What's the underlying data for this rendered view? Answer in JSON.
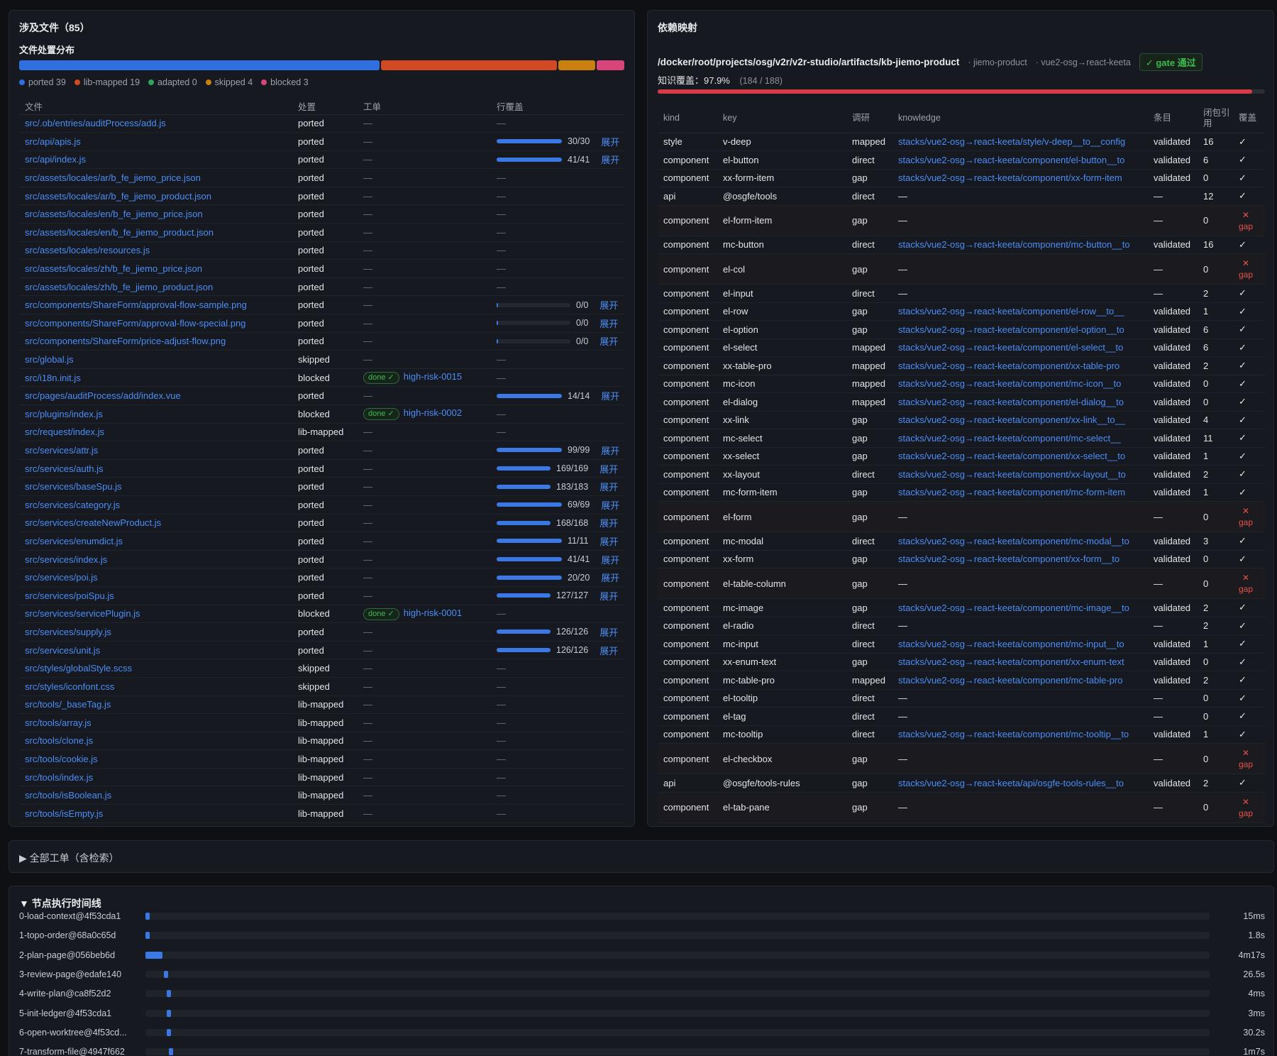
{
  "left": {
    "title": "涉及文件（85）",
    "dist_title": "文件处置分布",
    "dist": [
      {
        "name": "ported",
        "count": 39,
        "color": "#2f6fe0"
      },
      {
        "name": "lib-mapped",
        "count": 19,
        "color": "#d14a24"
      },
      {
        "name": "adapted",
        "count": 0,
        "color": "#2ea35b"
      },
      {
        "name": "skipped",
        "count": 4,
        "color": "#c9800e"
      },
      {
        "name": "blocked",
        "count": 3,
        "color": "#d8457a"
      }
    ],
    "legend": [
      "ported 39",
      "lib-mapped 19",
      "adapted 0",
      "skipped 4",
      "blocked 3"
    ],
    "headers": {
      "file": "文件",
      "disp": "处置",
      "ticket": "工单",
      "cov": "行覆盖"
    },
    "expand_label": "展开",
    "rows": [
      {
        "file": "src/.ob/entries/auditProcess/add.js",
        "disp": "ported",
        "ticket": "—",
        "done": "",
        "cov": "—",
        "frac": null
      },
      {
        "file": "src/api/apis.js",
        "disp": "ported",
        "ticket": "—",
        "done": "",
        "cov": "30/30",
        "frac": 1
      },
      {
        "file": "src/api/index.js",
        "disp": "ported",
        "ticket": "—",
        "done": "",
        "cov": "41/41",
        "frac": 1
      },
      {
        "file": "src/assets/locales/ar/b_fe_jiemo_price.json",
        "disp": "ported",
        "ticket": "—",
        "done": "",
        "cov": "—",
        "frac": null
      },
      {
        "file": "src/assets/locales/ar/b_fe_jiemo_product.json",
        "disp": "ported",
        "ticket": "—",
        "done": "",
        "cov": "—",
        "frac": null
      },
      {
        "file": "src/assets/locales/en/b_fe_jiemo_price.json",
        "disp": "ported",
        "ticket": "—",
        "done": "",
        "cov": "—",
        "frac": null
      },
      {
        "file": "src/assets/locales/en/b_fe_jiemo_product.json",
        "disp": "ported",
        "ticket": "—",
        "done": "",
        "cov": "—",
        "frac": null
      },
      {
        "file": "src/assets/locales/resources.js",
        "disp": "ported",
        "ticket": "—",
        "done": "",
        "cov": "—",
        "frac": null
      },
      {
        "file": "src/assets/locales/zh/b_fe_jiemo_price.json",
        "disp": "ported",
        "ticket": "—",
        "done": "",
        "cov": "—",
        "frac": null
      },
      {
        "file": "src/assets/locales/zh/b_fe_jiemo_product.json",
        "disp": "ported",
        "ticket": "—",
        "done": "",
        "cov": "—",
        "frac": null
      },
      {
        "file": "src/components/ShareForm/approval-flow-sample.png",
        "disp": "ported",
        "ticket": "—",
        "done": "",
        "cov": "0/0",
        "frac": 0
      },
      {
        "file": "src/components/ShareForm/approval-flow-special.png",
        "disp": "ported",
        "ticket": "—",
        "done": "",
        "cov": "0/0",
        "frac": 0
      },
      {
        "file": "src/components/ShareForm/price-adjust-flow.png",
        "disp": "ported",
        "ticket": "—",
        "done": "",
        "cov": "0/0",
        "frac": 0
      },
      {
        "file": "src/global.js",
        "disp": "skipped",
        "ticket": "—",
        "done": "",
        "cov": "—",
        "frac": null
      },
      {
        "file": "src/i18n.init.js",
        "disp": "blocked",
        "ticket": "high-risk-0015",
        "done": "done ✓",
        "cov": "—",
        "frac": null
      },
      {
        "file": "src/pages/auditProcess/add/index.vue",
        "disp": "ported",
        "ticket": "—",
        "done": "",
        "cov": "14/14",
        "frac": 1
      },
      {
        "file": "src/plugins/index.js",
        "disp": "blocked",
        "ticket": "high-risk-0002",
        "done": "done ✓",
        "cov": "—",
        "frac": null
      },
      {
        "file": "src/request/index.js",
        "disp": "lib-mapped",
        "ticket": "—",
        "done": "",
        "cov": "—",
        "frac": null
      },
      {
        "file": "src/services/attr.js",
        "disp": "ported",
        "ticket": "—",
        "done": "",
        "cov": "99/99",
        "frac": 1
      },
      {
        "file": "src/services/auth.js",
        "disp": "ported",
        "ticket": "—",
        "done": "",
        "cov": "169/169",
        "frac": 1
      },
      {
        "file": "src/services/baseSpu.js",
        "disp": "ported",
        "ticket": "—",
        "done": "",
        "cov": "183/183",
        "frac": 1
      },
      {
        "file": "src/services/category.js",
        "disp": "ported",
        "ticket": "—",
        "done": "",
        "cov": "69/69",
        "frac": 1
      },
      {
        "file": "src/services/createNewProduct.js",
        "disp": "ported",
        "ticket": "—",
        "done": "",
        "cov": "168/168",
        "frac": 1
      },
      {
        "file": "src/services/enumdict.js",
        "disp": "ported",
        "ticket": "—",
        "done": "",
        "cov": "11/11",
        "frac": 1
      },
      {
        "file": "src/services/index.js",
        "disp": "ported",
        "ticket": "—",
        "done": "",
        "cov": "41/41",
        "frac": 1
      },
      {
        "file": "src/services/poi.js",
        "disp": "ported",
        "ticket": "—",
        "done": "",
        "cov": "20/20",
        "frac": 1
      },
      {
        "file": "src/services/poiSpu.js",
        "disp": "ported",
        "ticket": "—",
        "done": "",
        "cov": "127/127",
        "frac": 1
      },
      {
        "file": "src/services/servicePlugin.js",
        "disp": "blocked",
        "ticket": "high-risk-0001",
        "done": "done ✓",
        "cov": "—",
        "frac": null
      },
      {
        "file": "src/services/supply.js",
        "disp": "ported",
        "ticket": "—",
        "done": "",
        "cov": "126/126",
        "frac": 1
      },
      {
        "file": "src/services/unit.js",
        "disp": "ported",
        "ticket": "—",
        "done": "",
        "cov": "126/126",
        "frac": 1
      },
      {
        "file": "src/styles/globalStyle.scss",
        "disp": "skipped",
        "ticket": "—",
        "done": "",
        "cov": "—",
        "frac": null
      },
      {
        "file": "src/styles/iconfont.css",
        "disp": "skipped",
        "ticket": "—",
        "done": "",
        "cov": "—",
        "frac": null
      },
      {
        "file": "src/tools/_baseTag.js",
        "disp": "lib-mapped",
        "ticket": "—",
        "done": "",
        "cov": "—",
        "frac": null
      },
      {
        "file": "src/tools/array.js",
        "disp": "lib-mapped",
        "ticket": "—",
        "done": "",
        "cov": "—",
        "frac": null
      },
      {
        "file": "src/tools/clone.js",
        "disp": "lib-mapped",
        "ticket": "—",
        "done": "",
        "cov": "—",
        "frac": null
      },
      {
        "file": "src/tools/cookie.js",
        "disp": "lib-mapped",
        "ticket": "—",
        "done": "",
        "cov": "—",
        "frac": null
      },
      {
        "file": "src/tools/index.js",
        "disp": "lib-mapped",
        "ticket": "—",
        "done": "",
        "cov": "—",
        "frac": null
      },
      {
        "file": "src/tools/isBoolean.js",
        "disp": "lib-mapped",
        "ticket": "—",
        "done": "",
        "cov": "—",
        "frac": null
      },
      {
        "file": "src/tools/isEmpty.js",
        "disp": "lib-mapped",
        "ticket": "—",
        "done": "",
        "cov": "—",
        "frac": null
      }
    ]
  },
  "right": {
    "title": "依赖映射",
    "path": "/docker/root/projects/osg/v2r/v2r-studio/artifacts/kb-jiemo-product",
    "tag1": "· jiemo-product",
    "tag2": "· vue2-osg→react-keeta",
    "gate": "✓ gate 通过",
    "kcov_label": "知识覆盖：97.9%",
    "kcov_count": "(184 / 188)",
    "kcov_frac": 0.979,
    "headers": {
      "kind": "kind",
      "key": "key",
      "research": "调研",
      "knowledge": "knowledge",
      "entry": "条目",
      "refs": "闭包引用",
      "cover": "覆盖"
    },
    "rows": [
      {
        "kind": "style",
        "key": "v-deep",
        "research": "mapped",
        "knowledge": "stacks/vue2-osg→react-keeta/style/v-deep__to__config",
        "entry": "validated",
        "refs": "16",
        "ok": true
      },
      {
        "kind": "component",
        "key": "el-button",
        "research": "direct",
        "knowledge": "stacks/vue2-osg→react-keeta/component/el-button__to",
        "entry": "validated",
        "refs": "6",
        "ok": true
      },
      {
        "kind": "component",
        "key": "xx-form-item",
        "research": "gap",
        "knowledge": "stacks/vue2-osg→react-keeta/component/xx-form-item",
        "entry": "validated",
        "refs": "0",
        "ok": true
      },
      {
        "kind": "api",
        "key": "@osgfe/tools",
        "research": "direct",
        "knowledge": "—",
        "entry": "—",
        "refs": "12",
        "ok": true
      },
      {
        "kind": "component",
        "key": "el-form-item",
        "research": "gap",
        "knowledge": "—",
        "entry": "—",
        "refs": "0",
        "ok": false
      },
      {
        "kind": "component",
        "key": "mc-button",
        "research": "direct",
        "knowledge": "stacks/vue2-osg→react-keeta/component/mc-button__to",
        "entry": "validated",
        "refs": "16",
        "ok": true
      },
      {
        "kind": "component",
        "key": "el-col",
        "research": "gap",
        "knowledge": "—",
        "entry": "—",
        "refs": "0",
        "ok": false
      },
      {
        "kind": "component",
        "key": "el-input",
        "research": "direct",
        "knowledge": "—",
        "entry": "—",
        "refs": "2",
        "ok": true
      },
      {
        "kind": "component",
        "key": "el-row",
        "research": "gap",
        "knowledge": "stacks/vue2-osg→react-keeta/component/el-row__to__",
        "entry": "validated",
        "refs": "1",
        "ok": true
      },
      {
        "kind": "component",
        "key": "el-option",
        "research": "gap",
        "knowledge": "stacks/vue2-osg→react-keeta/component/el-option__to",
        "entry": "validated",
        "refs": "6",
        "ok": true
      },
      {
        "kind": "component",
        "key": "el-select",
        "research": "mapped",
        "knowledge": "stacks/vue2-osg→react-keeta/component/el-select__to",
        "entry": "validated",
        "refs": "6",
        "ok": true
      },
      {
        "kind": "component",
        "key": "xx-table-pro",
        "research": "mapped",
        "knowledge": "stacks/vue2-osg→react-keeta/component/xx-table-pro",
        "entry": "validated",
        "refs": "2",
        "ok": true
      },
      {
        "kind": "component",
        "key": "mc-icon",
        "research": "mapped",
        "knowledge": "stacks/vue2-osg→react-keeta/component/mc-icon__to",
        "entry": "validated",
        "refs": "0",
        "ok": true
      },
      {
        "kind": "component",
        "key": "el-dialog",
        "research": "mapped",
        "knowledge": "stacks/vue2-osg→react-keeta/component/el-dialog__to",
        "entry": "validated",
        "refs": "0",
        "ok": true
      },
      {
        "kind": "component",
        "key": "xx-link",
        "research": "gap",
        "knowledge": "stacks/vue2-osg→react-keeta/component/xx-link__to__",
        "entry": "validated",
        "refs": "4",
        "ok": true
      },
      {
        "kind": "component",
        "key": "mc-select",
        "research": "gap",
        "knowledge": "stacks/vue2-osg→react-keeta/component/mc-select__",
        "entry": "validated",
        "refs": "11",
        "ok": true
      },
      {
        "kind": "component",
        "key": "xx-select",
        "research": "gap",
        "knowledge": "stacks/vue2-osg→react-keeta/component/xx-select__to",
        "entry": "validated",
        "refs": "1",
        "ok": true
      },
      {
        "kind": "component",
        "key": "xx-layout",
        "research": "direct",
        "knowledge": "stacks/vue2-osg→react-keeta/component/xx-layout__to",
        "entry": "validated",
        "refs": "2",
        "ok": true
      },
      {
        "kind": "component",
        "key": "mc-form-item",
        "research": "gap",
        "knowledge": "stacks/vue2-osg→react-keeta/component/mc-form-item",
        "entry": "validated",
        "refs": "1",
        "ok": true
      },
      {
        "kind": "component",
        "key": "el-form",
        "research": "gap",
        "knowledge": "—",
        "entry": "—",
        "refs": "0",
        "ok": false
      },
      {
        "kind": "component",
        "key": "mc-modal",
        "research": "direct",
        "knowledge": "stacks/vue2-osg→react-keeta/component/mc-modal__to",
        "entry": "validated",
        "refs": "3",
        "ok": true
      },
      {
        "kind": "component",
        "key": "xx-form",
        "research": "gap",
        "knowledge": "stacks/vue2-osg→react-keeta/component/xx-form__to",
        "entry": "validated",
        "refs": "0",
        "ok": true
      },
      {
        "kind": "component",
        "key": "el-table-column",
        "research": "gap",
        "knowledge": "—",
        "entry": "—",
        "refs": "0",
        "ok": false
      },
      {
        "kind": "component",
        "key": "mc-image",
        "research": "gap",
        "knowledge": "stacks/vue2-osg→react-keeta/component/mc-image__to",
        "entry": "validated",
        "refs": "2",
        "ok": true
      },
      {
        "kind": "component",
        "key": "el-radio",
        "research": "direct",
        "knowledge": "—",
        "entry": "—",
        "refs": "2",
        "ok": true
      },
      {
        "kind": "component",
        "key": "mc-input",
        "research": "direct",
        "knowledge": "stacks/vue2-osg→react-keeta/component/mc-input__to",
        "entry": "validated",
        "refs": "1",
        "ok": true
      },
      {
        "kind": "component",
        "key": "xx-enum-text",
        "research": "gap",
        "knowledge": "stacks/vue2-osg→react-keeta/component/xx-enum-text",
        "entry": "validated",
        "refs": "0",
        "ok": true
      },
      {
        "kind": "component",
        "key": "mc-table-pro",
        "research": "mapped",
        "knowledge": "stacks/vue2-osg→react-keeta/component/mc-table-pro",
        "entry": "validated",
        "refs": "2",
        "ok": true
      },
      {
        "kind": "component",
        "key": "el-tooltip",
        "research": "direct",
        "knowledge": "—",
        "entry": "—",
        "refs": "0",
        "ok": true
      },
      {
        "kind": "component",
        "key": "el-tag",
        "research": "direct",
        "knowledge": "—",
        "entry": "—",
        "refs": "0",
        "ok": true
      },
      {
        "kind": "component",
        "key": "mc-tooltip",
        "research": "direct",
        "knowledge": "stacks/vue2-osg→react-keeta/component/mc-tooltip__to",
        "entry": "validated",
        "refs": "1",
        "ok": true
      },
      {
        "kind": "component",
        "key": "el-checkbox",
        "research": "gap",
        "knowledge": "—",
        "entry": "—",
        "refs": "0",
        "ok": false
      },
      {
        "kind": "api",
        "key": "@osgfe/tools-rules",
        "research": "gap",
        "knowledge": "stacks/vue2-osg→react-keeta/api/osgfe-tools-rules__to",
        "entry": "validated",
        "refs": "2",
        "ok": true
      },
      {
        "kind": "component",
        "key": "el-tab-pane",
        "research": "gap",
        "knowledge": "—",
        "entry": "—",
        "refs": "0",
        "ok": false
      }
    ],
    "ok_mark": "✓",
    "gap_mark": "✕",
    "gap_label": "gap"
  },
  "workorders": {
    "title": "▶ 全部工单（含检索）"
  },
  "timeline": {
    "title": "▼ 节点执行时间线",
    "rows": [
      {
        "label": "0-load-context@4f53cda1",
        "start": 0.0,
        "len": 0.004,
        "dur": "15ms"
      },
      {
        "label": "1-topo-order@68a0c65d",
        "start": 0.0,
        "len": 0.004,
        "dur": "1.8s"
      },
      {
        "label": "2-plan-page@056beb6d",
        "start": 0.0,
        "len": 0.016,
        "dur": "4m17s"
      },
      {
        "label": "3-review-page@edafe140",
        "start": 0.017,
        "len": 0.004,
        "dur": "26.5s"
      },
      {
        "label": "4-write-plan@ca8f52d2",
        "start": 0.02,
        "len": 0.004,
        "dur": "4ms"
      },
      {
        "label": "5-init-ledger@4f53cda1",
        "start": 0.02,
        "len": 0.004,
        "dur": "3ms"
      },
      {
        "label": "6-open-worktree@4f53cd...",
        "start": 0.02,
        "len": 0.004,
        "dur": "30.2s"
      },
      {
        "label": "7-transform-file@4947f662",
        "start": 0.022,
        "len": 0.004,
        "dur": "1m7s"
      }
    ]
  }
}
